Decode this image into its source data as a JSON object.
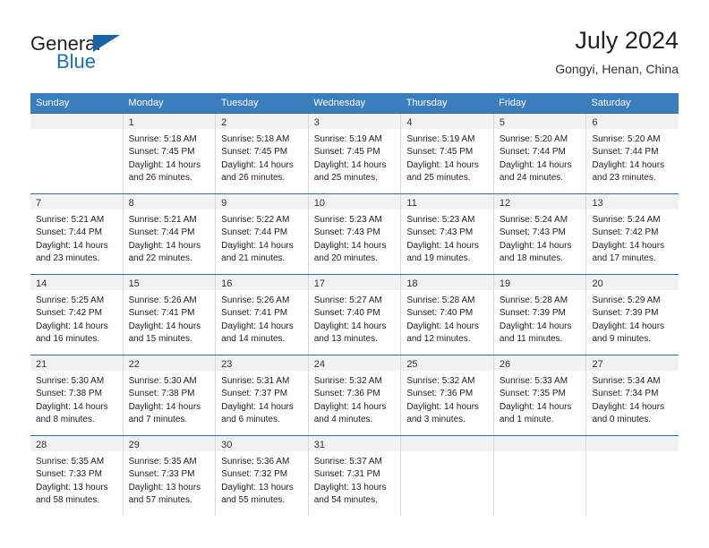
{
  "logo": {
    "word_general": "General",
    "word_blue": "Blue",
    "triangle_color": "#1565a8",
    "blue_color": "#1571bd"
  },
  "header": {
    "title": "July 2024",
    "subtitle": "Gongyi, Henan, China"
  },
  "theme": {
    "header_bg": "#3a7ebe",
    "row_border": "#2e6da4",
    "cell_border": "#d9d9d9",
    "day_band_bg": "#f2f2f2"
  },
  "weekdays": [
    "Sunday",
    "Monday",
    "Tuesday",
    "Wednesday",
    "Thursday",
    "Friday",
    "Saturday"
  ],
  "weeks": [
    [
      {
        "day": "",
        "l1": "",
        "l2": "",
        "l3": "",
        "l4": ""
      },
      {
        "day": "1",
        "l1": "Sunrise: 5:18 AM",
        "l2": "Sunset: 7:45 PM",
        "l3": "Daylight: 14 hours",
        "l4": "and 26 minutes."
      },
      {
        "day": "2",
        "l1": "Sunrise: 5:18 AM",
        "l2": "Sunset: 7:45 PM",
        "l3": "Daylight: 14 hours",
        "l4": "and 26 minutes."
      },
      {
        "day": "3",
        "l1": "Sunrise: 5:19 AM",
        "l2": "Sunset: 7:45 PM",
        "l3": "Daylight: 14 hours",
        "l4": "and 25 minutes."
      },
      {
        "day": "4",
        "l1": "Sunrise: 5:19 AM",
        "l2": "Sunset: 7:45 PM",
        "l3": "Daylight: 14 hours",
        "l4": "and 25 minutes."
      },
      {
        "day": "5",
        "l1": "Sunrise: 5:20 AM",
        "l2": "Sunset: 7:44 PM",
        "l3": "Daylight: 14 hours",
        "l4": "and 24 minutes."
      },
      {
        "day": "6",
        "l1": "Sunrise: 5:20 AM",
        "l2": "Sunset: 7:44 PM",
        "l3": "Daylight: 14 hours",
        "l4": "and 23 minutes."
      }
    ],
    [
      {
        "day": "7",
        "l1": "Sunrise: 5:21 AM",
        "l2": "Sunset: 7:44 PM",
        "l3": "Daylight: 14 hours",
        "l4": "and 23 minutes."
      },
      {
        "day": "8",
        "l1": "Sunrise: 5:21 AM",
        "l2": "Sunset: 7:44 PM",
        "l3": "Daylight: 14 hours",
        "l4": "and 22 minutes."
      },
      {
        "day": "9",
        "l1": "Sunrise: 5:22 AM",
        "l2": "Sunset: 7:44 PM",
        "l3": "Daylight: 14 hours",
        "l4": "and 21 minutes."
      },
      {
        "day": "10",
        "l1": "Sunrise: 5:23 AM",
        "l2": "Sunset: 7:43 PM",
        "l3": "Daylight: 14 hours",
        "l4": "and 20 minutes."
      },
      {
        "day": "11",
        "l1": "Sunrise: 5:23 AM",
        "l2": "Sunset: 7:43 PM",
        "l3": "Daylight: 14 hours",
        "l4": "and 19 minutes."
      },
      {
        "day": "12",
        "l1": "Sunrise: 5:24 AM",
        "l2": "Sunset: 7:43 PM",
        "l3": "Daylight: 14 hours",
        "l4": "and 18 minutes."
      },
      {
        "day": "13",
        "l1": "Sunrise: 5:24 AM",
        "l2": "Sunset: 7:42 PM",
        "l3": "Daylight: 14 hours",
        "l4": "and 17 minutes."
      }
    ],
    [
      {
        "day": "14",
        "l1": "Sunrise: 5:25 AM",
        "l2": "Sunset: 7:42 PM",
        "l3": "Daylight: 14 hours",
        "l4": "and 16 minutes."
      },
      {
        "day": "15",
        "l1": "Sunrise: 5:26 AM",
        "l2": "Sunset: 7:41 PM",
        "l3": "Daylight: 14 hours",
        "l4": "and 15 minutes."
      },
      {
        "day": "16",
        "l1": "Sunrise: 5:26 AM",
        "l2": "Sunset: 7:41 PM",
        "l3": "Daylight: 14 hours",
        "l4": "and 14 minutes."
      },
      {
        "day": "17",
        "l1": "Sunrise: 5:27 AM",
        "l2": "Sunset: 7:40 PM",
        "l3": "Daylight: 14 hours",
        "l4": "and 13 minutes."
      },
      {
        "day": "18",
        "l1": "Sunrise: 5:28 AM",
        "l2": "Sunset: 7:40 PM",
        "l3": "Daylight: 14 hours",
        "l4": "and 12 minutes."
      },
      {
        "day": "19",
        "l1": "Sunrise: 5:28 AM",
        "l2": "Sunset: 7:39 PM",
        "l3": "Daylight: 14 hours",
        "l4": "and 11 minutes."
      },
      {
        "day": "20",
        "l1": "Sunrise: 5:29 AM",
        "l2": "Sunset: 7:39 PM",
        "l3": "Daylight: 14 hours",
        "l4": "and 9 minutes."
      }
    ],
    [
      {
        "day": "21",
        "l1": "Sunrise: 5:30 AM",
        "l2": "Sunset: 7:38 PM",
        "l3": "Daylight: 14 hours",
        "l4": "and 8 minutes."
      },
      {
        "day": "22",
        "l1": "Sunrise: 5:30 AM",
        "l2": "Sunset: 7:38 PM",
        "l3": "Daylight: 14 hours",
        "l4": "and 7 minutes."
      },
      {
        "day": "23",
        "l1": "Sunrise: 5:31 AM",
        "l2": "Sunset: 7:37 PM",
        "l3": "Daylight: 14 hours",
        "l4": "and 6 minutes."
      },
      {
        "day": "24",
        "l1": "Sunrise: 5:32 AM",
        "l2": "Sunset: 7:36 PM",
        "l3": "Daylight: 14 hours",
        "l4": "and 4 minutes."
      },
      {
        "day": "25",
        "l1": "Sunrise: 5:32 AM",
        "l2": "Sunset: 7:36 PM",
        "l3": "Daylight: 14 hours",
        "l4": "and 3 minutes."
      },
      {
        "day": "26",
        "l1": "Sunrise: 5:33 AM",
        "l2": "Sunset: 7:35 PM",
        "l3": "Daylight: 14 hours",
        "l4": "and 1 minute."
      },
      {
        "day": "27",
        "l1": "Sunrise: 5:34 AM",
        "l2": "Sunset: 7:34 PM",
        "l3": "Daylight: 14 hours",
        "l4": "and 0 minutes."
      }
    ],
    [
      {
        "day": "28",
        "l1": "Sunrise: 5:35 AM",
        "l2": "Sunset: 7:33 PM",
        "l3": "Daylight: 13 hours",
        "l4": "and 58 minutes."
      },
      {
        "day": "29",
        "l1": "Sunrise: 5:35 AM",
        "l2": "Sunset: 7:33 PM",
        "l3": "Daylight: 13 hours",
        "l4": "and 57 minutes."
      },
      {
        "day": "30",
        "l1": "Sunrise: 5:36 AM",
        "l2": "Sunset: 7:32 PM",
        "l3": "Daylight: 13 hours",
        "l4": "and 55 minutes."
      },
      {
        "day": "31",
        "l1": "Sunrise: 5:37 AM",
        "l2": "Sunset: 7:31 PM",
        "l3": "Daylight: 13 hours",
        "l4": "and 54 minutes."
      },
      {
        "day": "",
        "l1": "",
        "l2": "",
        "l3": "",
        "l4": ""
      },
      {
        "day": "",
        "l1": "",
        "l2": "",
        "l3": "",
        "l4": ""
      },
      {
        "day": "",
        "l1": "",
        "l2": "",
        "l3": "",
        "l4": ""
      }
    ]
  ]
}
